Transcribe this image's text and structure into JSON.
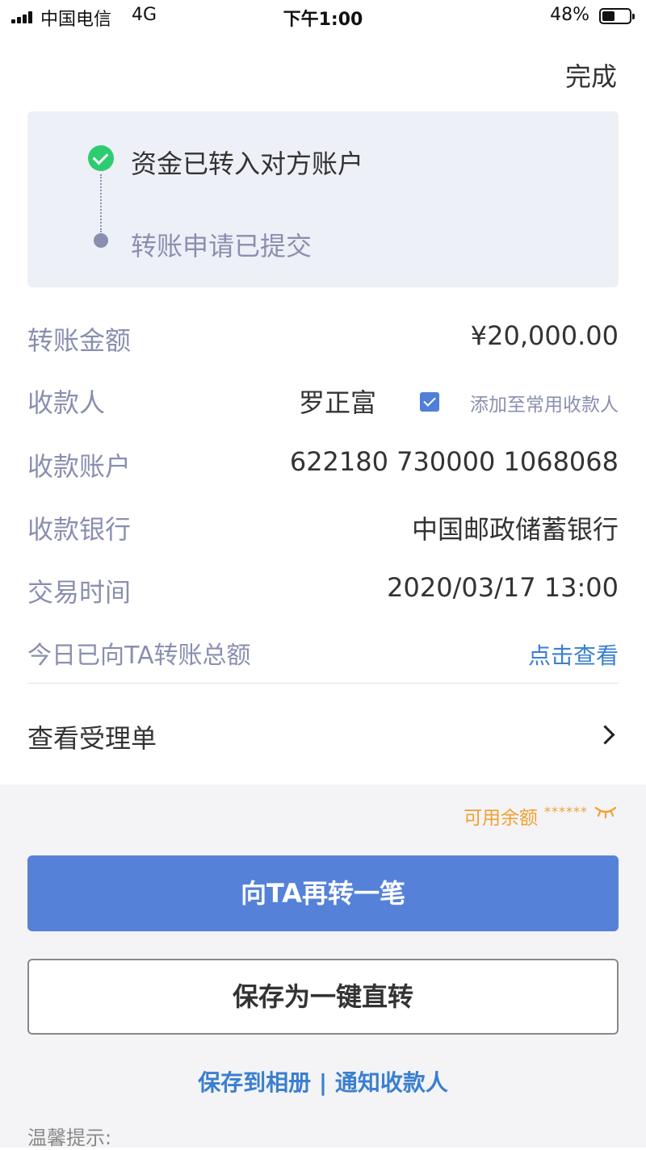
{
  "status_bar": {
    "carrier": "中国电信",
    "network": "4G",
    "time": "下午1:00",
    "battery": "48%",
    "battery_level": 0.48
  },
  "nav": {
    "done_label": "完成"
  },
  "progress": {
    "steps": [
      {
        "label": "资金已转入对方账户",
        "status": "complete"
      },
      {
        "label": "转账申请已提交",
        "status": "done-muted"
      }
    ],
    "colors": {
      "complete": "#2ecc71",
      "muted": "#8a8fb0",
      "card_bg": "#eef0f7"
    }
  },
  "details": {
    "amount": {
      "label": "转账金额",
      "value": "¥20,000.00"
    },
    "payee": {
      "label": "收款人",
      "name": "罗正富",
      "add_label": "添加至常用收款人",
      "add_checked": true
    },
    "account": {
      "label": "收款账户",
      "value": "622180 730000 1068068"
    },
    "bank": {
      "label": "收款银行",
      "value": "中国邮政储蓄银行"
    },
    "time": {
      "label": "交易时间",
      "value": "2020/03/17 13:00"
    },
    "today_total": {
      "label": "今日已向TA转账总额",
      "link": "点击查看"
    }
  },
  "receipt": {
    "label": "查看受理单"
  },
  "balance": {
    "label": "可用余额",
    "mask": "******",
    "color": "#f0a030"
  },
  "actions": {
    "primary_label": "向TA再转一笔",
    "primary_color": "#5582d8",
    "secondary_label": "保存为一键直转",
    "save_album": "保存到相册",
    "separator": " | ",
    "notify_payee": "通知收款人",
    "link_color": "#3a7fd0"
  },
  "tips": {
    "label": "温馨提示:"
  }
}
